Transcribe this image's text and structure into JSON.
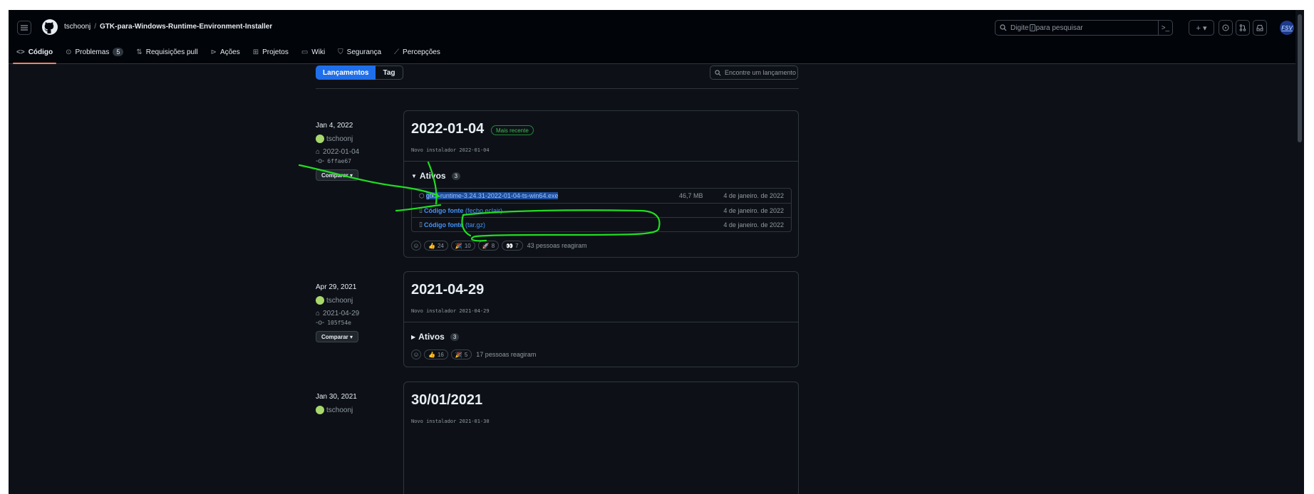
{
  "header": {
    "owner": "tschoonj",
    "separator": "/",
    "repo": "GTK-para-Windows-Runtime-Environment-Installer",
    "search_pre": "Digite",
    "search_key": "/",
    "search_post": "para pesquisar",
    "cmd_icon": ">_",
    "plus_label": "+ ▾",
    "user_initials": "FSV"
  },
  "nav": {
    "code": "Código",
    "issues": "Problemas",
    "issues_count": "5",
    "pulls": "Requisições pull",
    "actions": "Ações",
    "projects": "Projetos",
    "wiki": "Wiki",
    "security": "Segurança",
    "insights": "Percepções"
  },
  "toolbar": {
    "releases_tab": "Lançamentos",
    "tags_tab": "Tag",
    "find_placeholder": "Encontre um lançamento"
  },
  "releases": [
    {
      "date": "Jan 4, 2022",
      "author": "tschoonj",
      "tag": "2022-01-04",
      "commit": "6ffae67",
      "compare": "Comparar",
      "title": "2022-01-04",
      "badge": "Mais recente",
      "subtitle": "Novo instalador 2022-01-04",
      "assets_label": "Ativos",
      "assets_count": "3",
      "assets": [
        {
          "name": "gtk3-runtime-3.24.31-2022-01-04-ts-win64.exe",
          "size": "46,7 MB",
          "date": "4 de janeiro. de 2022"
        },
        {
          "name": "Código fonte",
          "ext": "(fecho eclair)",
          "date": "4 de janeiro. de 2022"
        },
        {
          "name": "Código fonte",
          "ext": "(tar.gz)",
          "date": "4 de janeiro. de 2022"
        }
      ],
      "reactions": [
        {
          "emoji": "👍",
          "count": "24"
        },
        {
          "emoji": "🎉",
          "count": "10"
        },
        {
          "emoji": "🚀",
          "count": "8"
        },
        {
          "emoji": "👀",
          "count": "7"
        }
      ],
      "reacted": "43 pessoas reagiram"
    },
    {
      "date": "Apr 29, 2021",
      "author": "tschoonj",
      "tag": "2021-04-29",
      "commit": "105f54e",
      "compare": "Comparar",
      "title": "2021-04-29",
      "subtitle": "Novo instalador 2021-04-29",
      "assets_label": "Ativos",
      "assets_count": "3",
      "reactions": [
        {
          "emoji": "👍",
          "count": "16"
        },
        {
          "emoji": "🎉",
          "count": "5"
        }
      ],
      "reacted": "17 pessoas reagiram"
    },
    {
      "date": "Jan 30, 2021",
      "author": "tschoonj",
      "title": "30/01/2021",
      "subtitle": "Novo instalador 2021-01-30"
    }
  ],
  "colors": {
    "bg": "#0d1117",
    "accent": "#1f6feb",
    "link": "#4493f8",
    "annotation": "#22dd22"
  }
}
